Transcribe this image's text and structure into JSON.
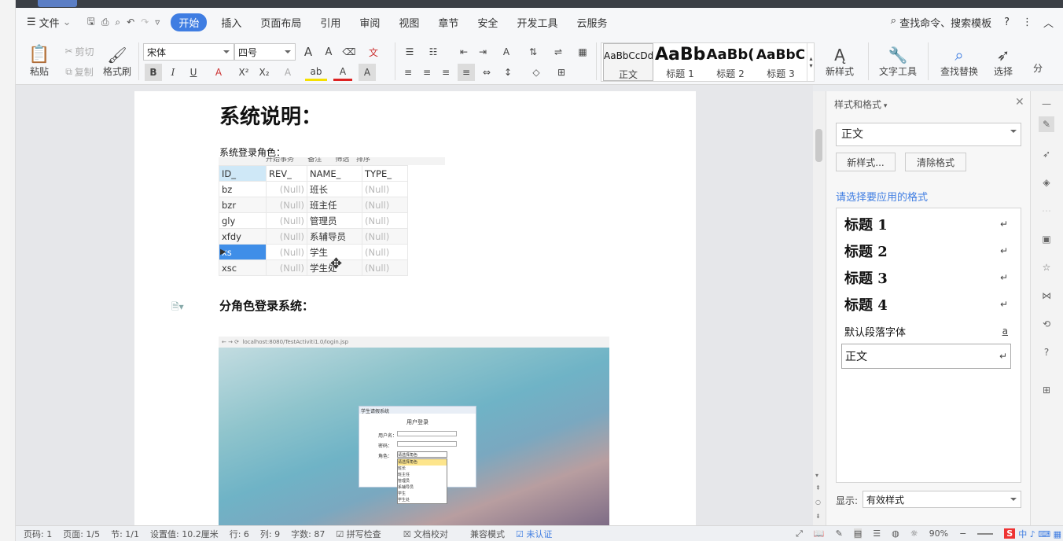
{
  "menu": {
    "file": "文件",
    "items": [
      "开始",
      "插入",
      "页面布局",
      "引用",
      "审阅",
      "视图",
      "章节",
      "安全",
      "开发工具",
      "云服务"
    ],
    "search": "查找命令、搜索模板",
    "help": "?"
  },
  "ribbon": {
    "paste": "粘贴",
    "cut": "剪切",
    "copy": "复制",
    "format_painter": "格式刷",
    "font": "宋体",
    "size": "四号",
    "bold": "B",
    "italic": "I",
    "underline": "U",
    "font_grow": "A",
    "font_shrink": "A",
    "super": "X²",
    "sub": "X₂",
    "styles": [
      {
        "preview": "AaBbCcDd",
        "label": "正文"
      },
      {
        "preview": "AaBb",
        "label": "标题 1"
      },
      {
        "preview": "AaBb(",
        "label": "标题 2"
      },
      {
        "preview": "AaBbC",
        "label": "标题 3"
      }
    ],
    "new_style": "新样式",
    "text_tools": "文字工具",
    "find_replace": "查找替换",
    "select": "选择",
    "more": "分"
  },
  "doc": {
    "heading": "系统说明：",
    "login_role_label": "系统登录角色：",
    "section2": "分角色登录系统：",
    "table": {
      "headers": [
        "ID_",
        "REV_",
        "NAME_",
        "TYPE_"
      ],
      "rows": [
        [
          "bz",
          "(Null)",
          "班长",
          "(Null)"
        ],
        [
          "bzr",
          "(Null)",
          "班主任",
          "(Null)"
        ],
        [
          "gly",
          "(Null)",
          "管理员",
          "(Null)"
        ],
        [
          "xfdy",
          "(Null)",
          "系辅导员",
          "(Null)"
        ],
        [
          "xs",
          "(Null)",
          "学生",
          "(Null)"
        ],
        [
          "xsc",
          "(Null)",
          "学生处",
          "(Null)"
        ]
      ]
    },
    "toolbar_text": [
      "开始事务",
      "备注",
      "筛选",
      "排序"
    ],
    "browser_url": "localhost:8080/TestActiviti1.0/login.jsp",
    "login": {
      "window_title": "学生请假系统",
      "title": "用户登录",
      "user_label": "用户名：",
      "pass_label": "密码：",
      "role_label": "角色：",
      "role_select": "请选择角色",
      "options": [
        "请选择角色",
        "班长",
        "班主任",
        "管理员",
        "系辅导员",
        "学生",
        "学生处"
      ]
    }
  },
  "panel": {
    "title": "样式和格式",
    "current": "正文",
    "new_btn": "新样式...",
    "clear_btn": "清除格式",
    "prompt": "请选择要应用的格式",
    "styles": [
      {
        "name": "标题 1",
        "mark": "↵"
      },
      {
        "name": "标题 2",
        "mark": "↵"
      },
      {
        "name": "标题 3",
        "mark": "↵"
      },
      {
        "name": "标题 4",
        "mark": "↵"
      },
      {
        "name": "默认段落字体",
        "mark": "a"
      },
      {
        "name": "正文",
        "mark": "↵"
      }
    ],
    "show_label": "显示:",
    "show_value": "有效样式"
  },
  "status": {
    "page_num": "页码: 1",
    "pages": "页面: 1/5",
    "section": "节: 1/1",
    "setting": "设置值: 10.2厘米",
    "row": "行: 6",
    "col": "列: 9",
    "words": "字数: 87",
    "spell": "拼写检查",
    "proof": "文档校对",
    "compat": "兼容模式",
    "cert": "未认证",
    "zoom": "90%"
  }
}
